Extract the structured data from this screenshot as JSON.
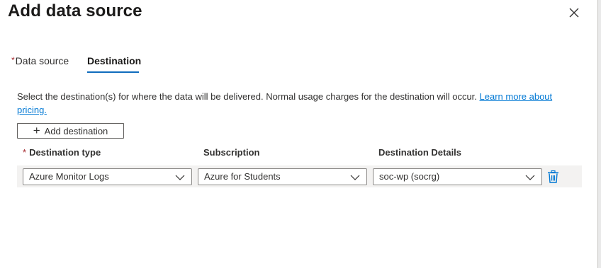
{
  "dialog": {
    "title": "Add data source"
  },
  "tabs": [
    {
      "label": "Data source",
      "required": "*"
    },
    {
      "label": "Destination",
      "selected": true
    }
  ],
  "description": {
    "text": "Select the destination(s) for where the data will be delivered. Normal usage charges for the destination will occur. ",
    "link": "Learn more about pricing."
  },
  "add_button": {
    "label": "Add destination",
    "icon": "plus-icon"
  },
  "columns": {
    "destination_type": {
      "label": "Destination type",
      "required": "*"
    },
    "subscription": {
      "label": "Subscription"
    },
    "destination_details": {
      "label": "Destination Details"
    }
  },
  "row": {
    "destination_type": "Azure Monitor Logs",
    "subscription": "Azure for Students",
    "destination_details": "soc-wp (socrg)"
  },
  "icons": {
    "close": "close-icon",
    "chevron": "chevron-down-icon",
    "delete": "trash-icon"
  },
  "colors": {
    "accent": "#0f6cbd",
    "link": "#0078d4",
    "required": "#a4262c",
    "row_background": "#f3f2f1"
  }
}
